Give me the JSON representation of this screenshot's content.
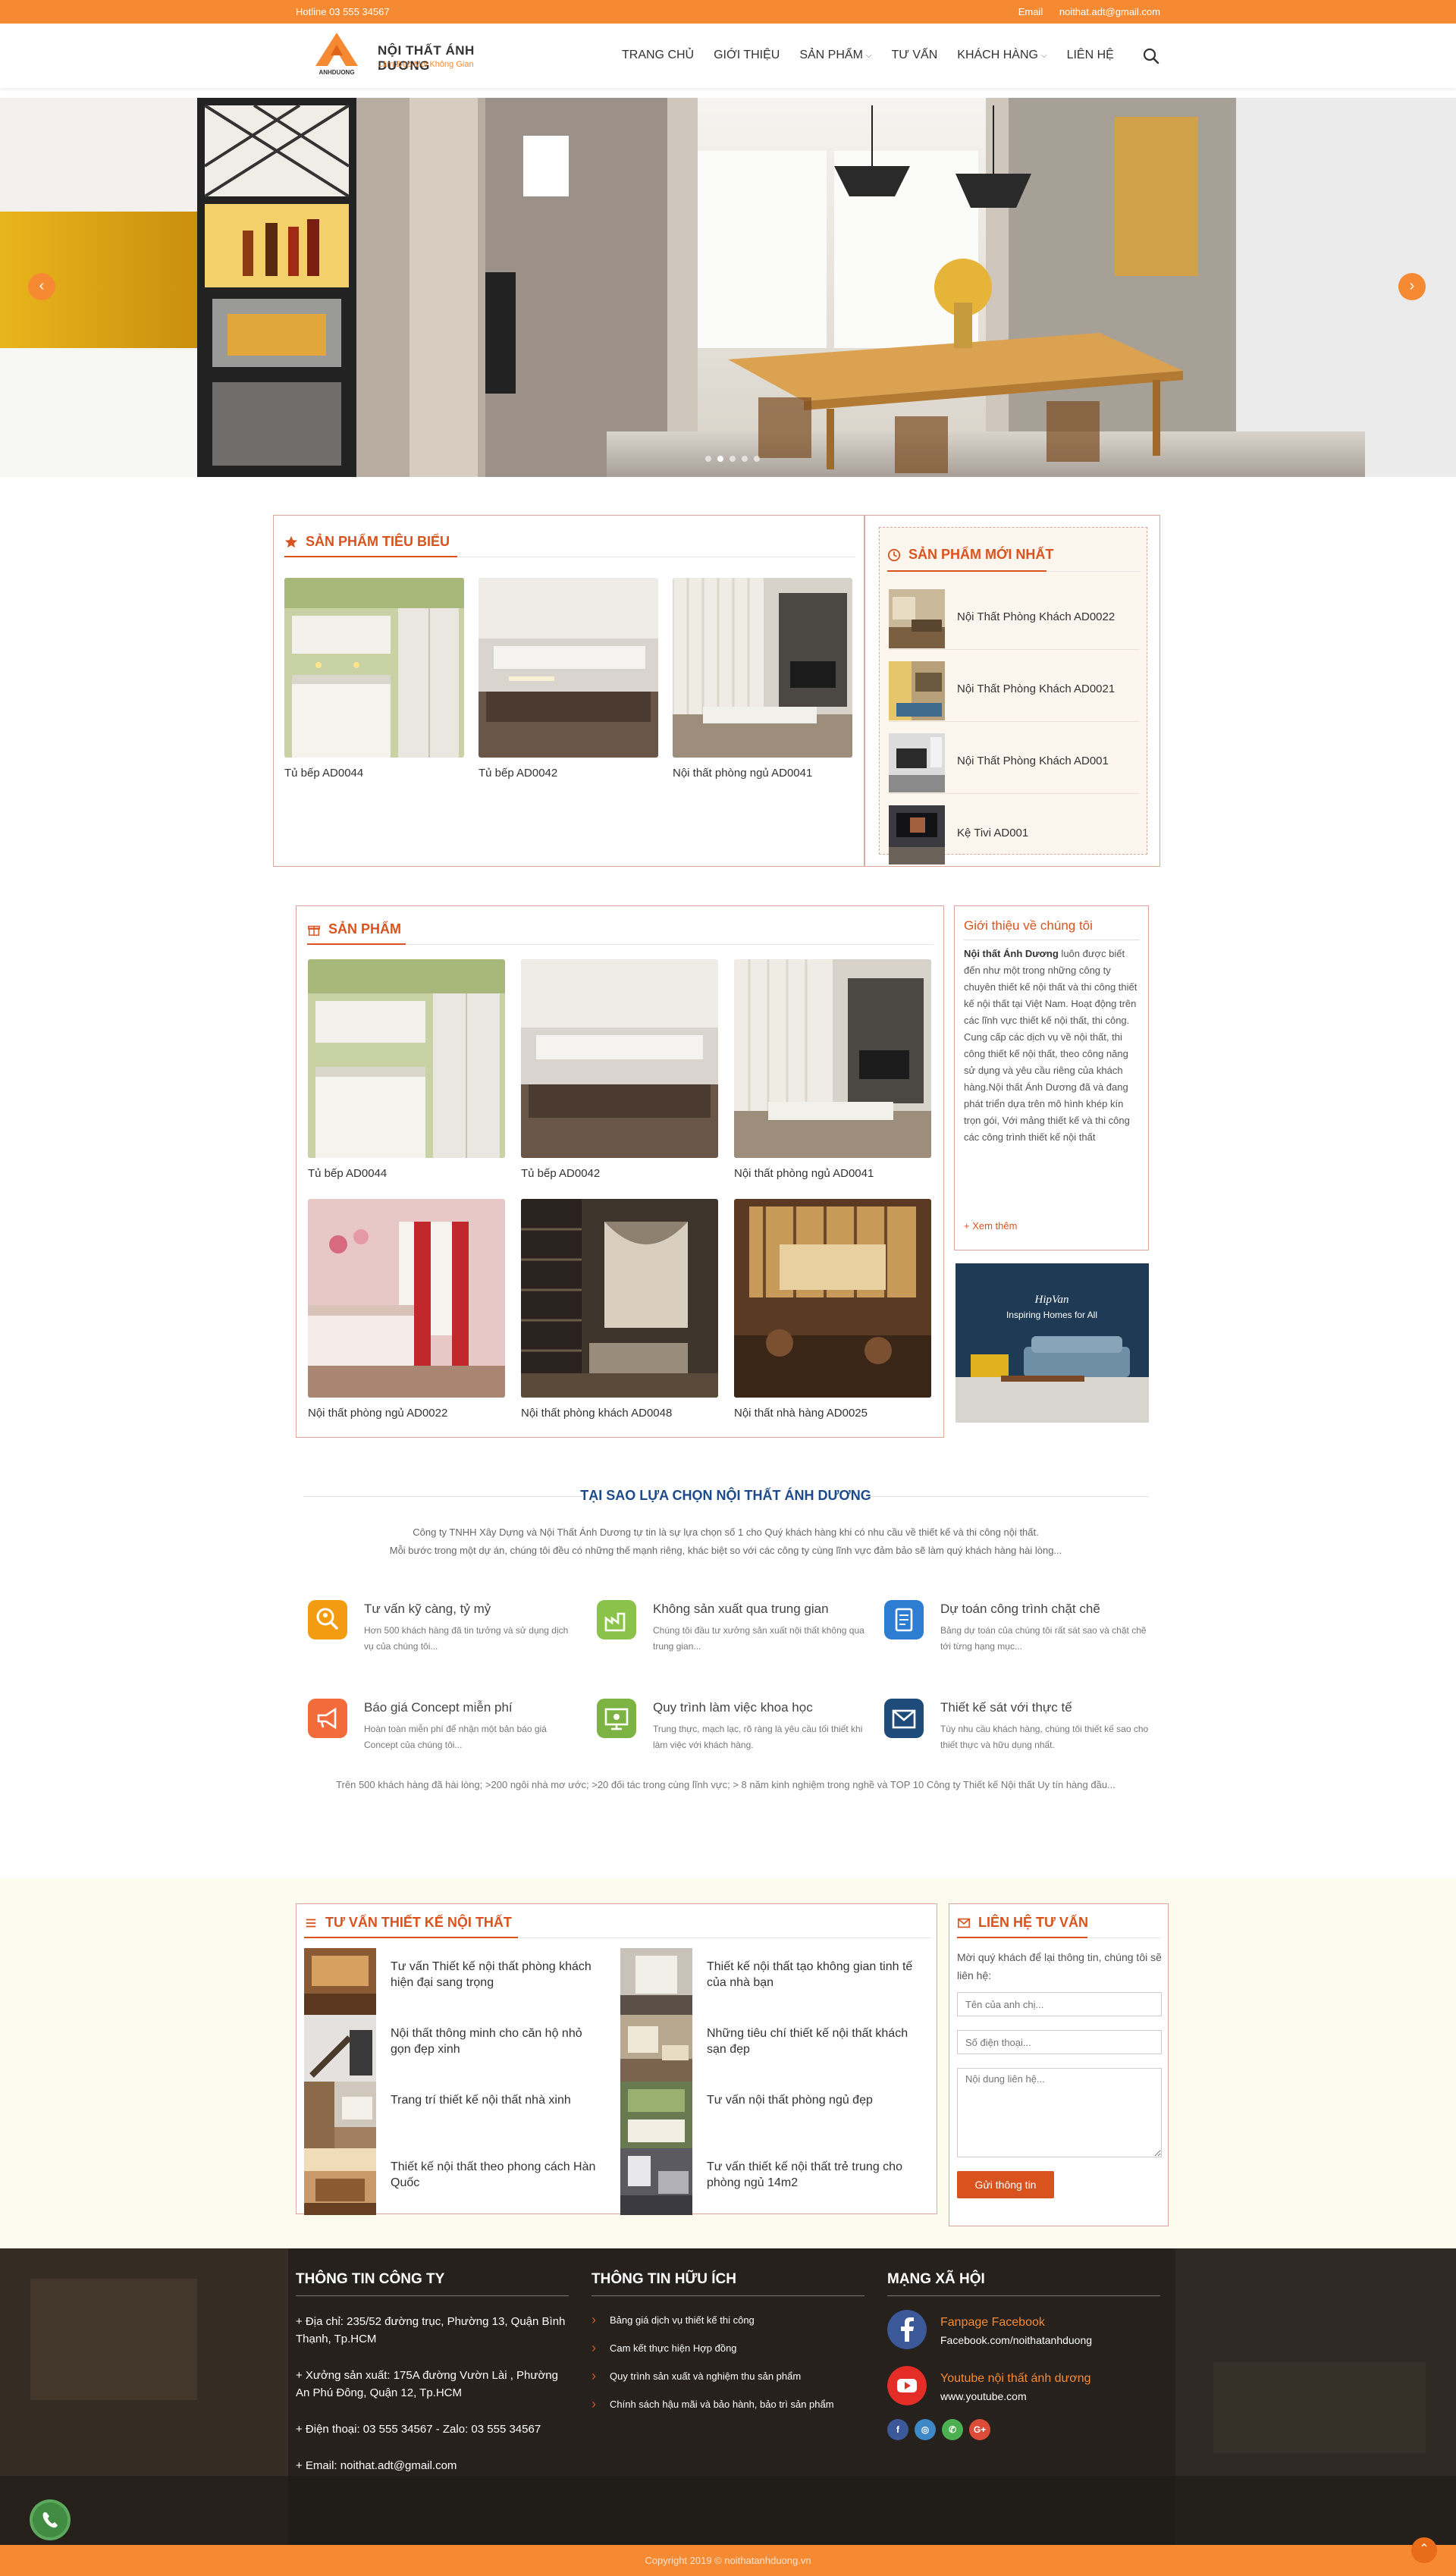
{
  "topbar": {
    "hotline": "Hotline 03 555 34567",
    "email_label": "Email",
    "email": "noithat.adt@gmail.com"
  },
  "brand": {
    "name": "NỘI THẤT ÁNH DƯƠNG",
    "slogan": "Làm Đẹp Mọi Không Gian",
    "mark_text": "ANHDUONG"
  },
  "nav": [
    {
      "label": "TRANG CHỦ"
    },
    {
      "label": "GIỚI THIỆU"
    },
    {
      "label": "SẢN PHẨM",
      "has_dropdown": true
    },
    {
      "label": "TƯ VẤN"
    },
    {
      "label": "KHÁCH HÀNG",
      "has_dropdown": true
    },
    {
      "label": "LIÊN HỆ"
    }
  ],
  "hero": {
    "prev": "‹",
    "next": "›",
    "slides": 5,
    "active_slide": 1
  },
  "featured": {
    "title": "SẢN PHẨM TIÊU BIỂU",
    "items": [
      "Tủ bếp AD0044",
      "Tủ bếp AD0042",
      "Nội thất phòng ngủ AD0041"
    ]
  },
  "newest": {
    "title": "SẢN PHẨM MỚI NHẤT",
    "items": [
      "Nội Thất Phòng Khách AD0022",
      "Nội Thất Phòng Khách AD0021",
      "Nội Thất Phòng Khách AD001",
      "Kệ Tivi AD001"
    ]
  },
  "products": {
    "title": "SẢN PHẨM",
    "items": [
      "Tủ bếp AD0044",
      "Tủ bếp AD0042",
      "Nội thất phòng ngủ AD0041",
      "Nội thất phòng ngủ AD0022",
      "Nội thất phòng khách AD0048",
      "Nội thất nhà hàng AD0025"
    ]
  },
  "about": {
    "title": "Giới thiệu về chúng tôi",
    "lead": "Nội thất Ánh Dương",
    "body": " luôn được biết đến như một trong những công ty chuyên thiết kế nội thất và thi công thiết kế nội thất tại Việt Nam. Hoạt động trên các lĩnh vực thiết kế nội thất, thi công. Cung cấp các dịch vụ về nội thất, thi công thiết kế nội thất, theo công năng sử dụng và yêu cầu riêng của khách hàng.Nội thất Ánh Dương đã và đang phát triển dựa trên mô hình khép kín trọn gói, Với mảng thiết kế và thi công các công trình thiết kế nội thất",
    "more": "+ Xem thêm"
  },
  "banner": {
    "brand": "HipVan",
    "tagline": "Inspiring Homes for All"
  },
  "why": {
    "title": "TẠI SAO LỰA CHỌN NỘI THẤT ÁNH DƯƠNG",
    "intro1": "Công ty TNHH Xây Dựng và Nội Thất Ánh Dương tự tin là sự lựa chọn số 1 cho Quý khách hàng khi có nhu cầu về thiết kế và thi công nội thất.",
    "intro2": "Mỗi bước trong một dự án, chúng tôi đều có những thế mạnh riêng, khác biệt so với các công ty cùng lĩnh vực đảm bảo sẽ làm quý khách hàng hài lòng...",
    "features": [
      {
        "title": "Tư vấn kỹ càng, tỷ mỷ",
        "desc": "Hơn 500 khách hàng đã tin tưởng và sử dụng dịch vụ của chúng tôi...",
        "color": "#f39c12",
        "icon": "search-person-icon"
      },
      {
        "title": "Không sản xuất qua trung gian",
        "desc": "Chúng tôi đầu tư xưởng sản xuất nội thất không qua trung gian...",
        "color": "#8bc34a",
        "icon": "factory-icon"
      },
      {
        "title": "Dự toán công trình chặt chẽ",
        "desc": "Bảng dự toán của chúng tôi rất sát sao và chặt chẽ tới từng hạng mục...",
        "color": "#2d7dd2",
        "icon": "document-icon"
      },
      {
        "title": "Báo giá Concept miễn phí",
        "desc": "Hoàn toàn miễn phí để nhận một bản báo giá Concept của chúng tôi...",
        "color": "#f26b3a",
        "icon": "megaphone-icon"
      },
      {
        "title": "Quy trình làm việc khoa học",
        "desc": "Trung thực, mạch lạc, rõ ràng là yêu cầu tối thiết khi làm việc với khách hàng.",
        "color": "#7cb342",
        "icon": "presentation-icon"
      },
      {
        "title": "Thiết kế sát với thực tế",
        "desc": "Tùy nhu cầu khách hàng, chúng tôi thiết kế sao cho thiết thực và hữu dụng nhất.",
        "color": "#1f4b7a",
        "icon": "mail-icon"
      }
    ],
    "footnote": "Trên 500 khách hàng đã hài lòng; >200 ngôi nhà mơ ước; >20 đối tác trong cùng lĩnh vực; > 8 năm kinh nghiệm trong nghề và TOP 10 Công ty Thiết kế Nội thất Uy tín hàng đầu..."
  },
  "advice": {
    "title": "TƯ VẤN THIẾT KẾ NỘI THẤT",
    "items": [
      "Tư vấn Thiết kế nội thất phòng khách hiện đại sang trọng",
      "Thiết kế nội thất tạo không gian tinh tế của nhà bạn",
      "Nội thất thông minh cho căn hộ nhỏ gọn đẹp xinh",
      "Những tiêu chí thiết kế nội thất khách sạn đẹp",
      "Trang trí thiết kế nội thất nhà xinh",
      "Tư vấn nội thất phòng ngủ đẹp",
      "Thiết kế nội thất theo phong cách Hàn Quốc",
      "Tư vấn thiết kế nội thất trẻ trung cho phòng ngủ 14m2"
    ]
  },
  "contact": {
    "title": "LIÊN HỆ TƯ VẤN",
    "desc": "Mời quý khách để lại thông tin, chúng tôi sẽ liên hệ:",
    "name_placeholder": "Tên của anh chị...",
    "phone_placeholder": "Số điện thoại...",
    "message_placeholder": "Nội dung liên hệ...",
    "submit": "Gửi thông tin"
  },
  "footer": {
    "company": {
      "title": "THÔNG TIN CÔNG TY",
      "address": "+ Địa chỉ: 235/52 đường trục, Phường 13, Quận Bình Thạnh, Tp.HCM",
      "workshop": "+ Xưởng sản xuất: 175A đường Vườn Lài , Phường An Phú Đông, Quận 12, Tp.HCM",
      "phone": "+ Điện thoại: 03 555 34567   - Zalo: 03 555 34567",
      "email": "+ Email: noithat.adt@gmail.com"
    },
    "useful": {
      "title": "THÔNG TIN HỮU ÍCH",
      "links": [
        "Bảng giá dịch vụ thiết kế thi công",
        "Cam kết thực hiện Hợp đồng",
        "Quy trình sản xuất và nghiệm thu sản phẩm",
        "Chính sách hậu mãi và bảo hành, bảo trì sản phẩm"
      ]
    },
    "social": {
      "title": "MẠNG XÃ HỘI",
      "facebook_title": "Fanpage Facebook",
      "facebook_url": "Facebook.com/noithatanhduong",
      "youtube_title": "Youtube nội thất ánh dương",
      "youtube_url": "www.youtube.com",
      "small": [
        "f",
        "◎",
        "✆",
        "G+"
      ]
    },
    "copyright": "Copyright 2019 © noithatanhduong.vn"
  },
  "colors": {
    "brand_orange": "#f58a33",
    "accent_red": "#d9531e",
    "nav_text": "#333333"
  }
}
